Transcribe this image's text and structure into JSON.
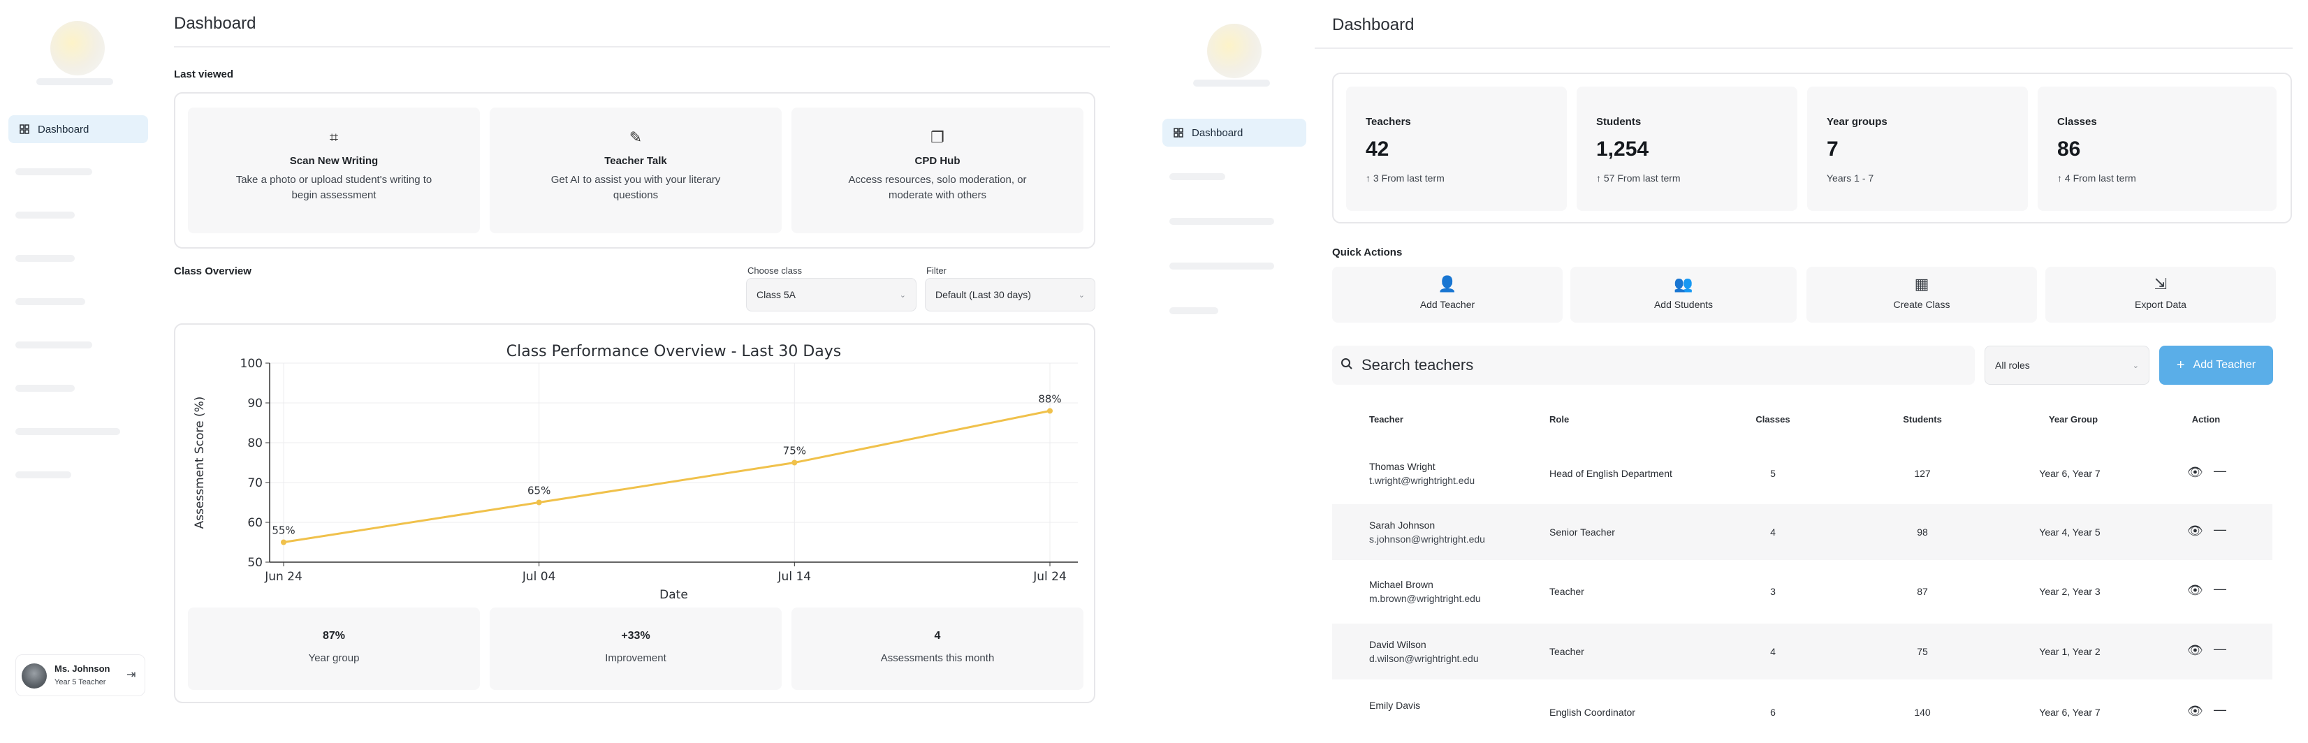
{
  "left": {
    "title": "Dashboard",
    "sidebar": {
      "active_item": "Dashboard"
    },
    "last_viewed_label": "Last viewed",
    "tiles": [
      {
        "icon": "scan-icon",
        "title": "Scan New Writing",
        "desc_line1": "Take a photo or upload student's writing to",
        "desc_line2": "begin assessment"
      },
      {
        "icon": "chat-icon",
        "title": "Teacher Talk",
        "desc_line1": "Get AI to assist you with your literary",
        "desc_line2": "questions"
      },
      {
        "icon": "copy-icon",
        "title": "CPD Hub",
        "desc_line1": "Access resources, solo moderation, or",
        "desc_line2": "moderate with others"
      }
    ],
    "class_overview_label": "Class Overview",
    "choose_class": {
      "label": "Choose class",
      "value": "Class 5A"
    },
    "filter": {
      "label": "Filter",
      "value": "Default (Last 30 days)"
    },
    "stats": [
      {
        "value": "87%",
        "label": "Year group"
      },
      {
        "value": "+33%",
        "label": "Improvement"
      },
      {
        "value": "4",
        "label": "Assessments this month"
      }
    ],
    "user": {
      "name": "Ms. Johnson",
      "role": "Year 5 Teacher"
    }
  },
  "chart_data": {
    "type": "line",
    "title": "Class Performance Overview - Last 30 Days",
    "xlabel": "Date",
    "ylabel": "Assessment Score (%)",
    "categories": [
      "Jun 24",
      "Jul 04",
      "Jul 14",
      "Jul 24"
    ],
    "values": [
      55,
      65,
      75,
      88
    ],
    "data_labels": [
      "55%",
      "65%",
      "75%",
      "88%"
    ],
    "ylim": [
      50,
      100
    ],
    "yticks": [
      "50",
      "60",
      "70",
      "80",
      "90",
      "100"
    ],
    "grid": true,
    "line_color": "#f0c14b"
  },
  "right": {
    "title": "Dashboard",
    "sidebar": {
      "active_item": "Dashboard"
    },
    "kpis": [
      {
        "label": "Teachers",
        "value": "42",
        "sub": "3 From last term",
        "arrow": "↑"
      },
      {
        "label": "Students",
        "value": "1,254",
        "sub": "57 From last term",
        "arrow": "↑"
      },
      {
        "label": "Year groups",
        "value": "7",
        "sub": "Years 1 - 7",
        "arrow": ""
      },
      {
        "label": "Classes",
        "value": "86",
        "sub": "4 From last term",
        "arrow": "↑"
      }
    ],
    "quick_actions_label": "Quick Actions",
    "quick_actions": [
      {
        "icon": "add-user-icon",
        "label": "Add Teacher"
      },
      {
        "icon": "users-icon",
        "label": "Add Students"
      },
      {
        "icon": "building-icon",
        "label": "Create Class"
      },
      {
        "icon": "export-icon",
        "label": "Export Data"
      }
    ],
    "search": {
      "placeholder": "Search teachers"
    },
    "roles_select": "All roles",
    "add_button": "Add Teacher",
    "table": {
      "headers": [
        "Teacher",
        "Role",
        "Classes",
        "Students",
        "Year Group",
        "Action"
      ],
      "rows": [
        {
          "name": "Thomas Wright",
          "email": "t.wright@wrightright.edu",
          "role": "Head of English Department",
          "classes": "5",
          "students": "127",
          "year_group": "Year 6, Year 7"
        },
        {
          "name": "Sarah Johnson",
          "email": "s.johnson@wrightright.edu",
          "role": "Senior Teacher",
          "classes": "4",
          "students": "98",
          "year_group": "Year 4, Year 5"
        },
        {
          "name": "Michael Brown",
          "email": "m.brown@wrightright.edu",
          "role": "Teacher",
          "classes": "3",
          "students": "87",
          "year_group": "Year 2, Year 3"
        },
        {
          "name": "David Wilson",
          "email": "d.wilson@wrightright.edu",
          "role": "Teacher",
          "classes": "4",
          "students": "75",
          "year_group": "Year 1, Year 2"
        },
        {
          "name": "Emily Davis",
          "email": "",
          "role": "English Coordinator",
          "classes": "6",
          "students": "140",
          "year_group": "Year 6, Year 7"
        }
      ]
    }
  }
}
